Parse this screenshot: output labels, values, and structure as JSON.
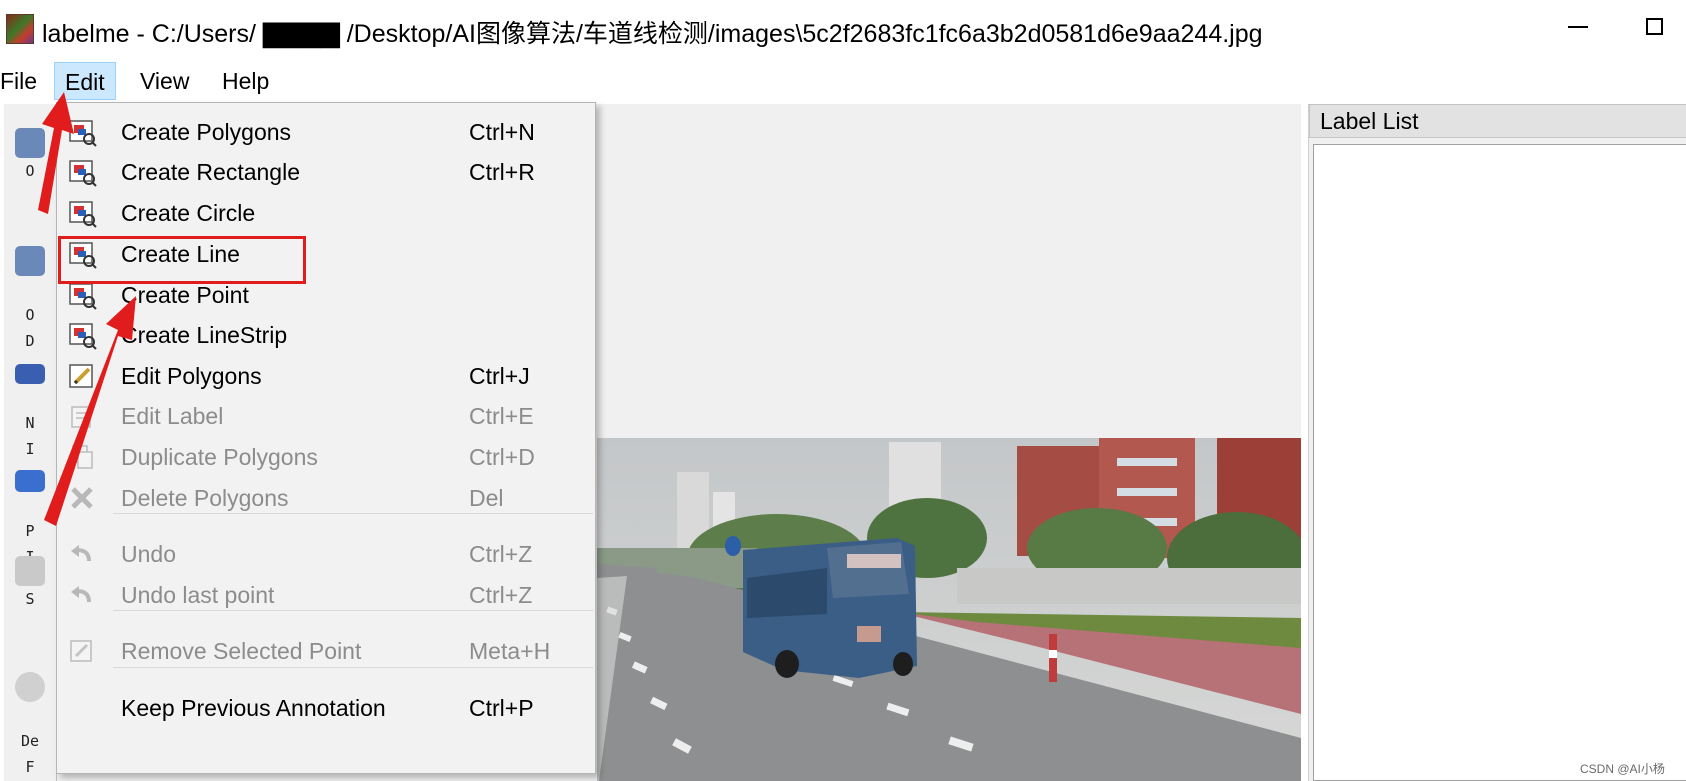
{
  "window": {
    "title": "labelme - C:/Users/ ▇▇▇▇ /Desktop/AI图像算法/车道线检测/images\\5c2f2683fc1fc6a3b2d0581d6e9aa244.jpg"
  },
  "menubar": [
    {
      "label": "File"
    },
    {
      "label": "Edit"
    },
    {
      "label": "View"
    },
    {
      "label": "Help"
    }
  ],
  "toolbar": [
    {
      "label": "O",
      "icon": "open-icon"
    },
    {
      "label": "O\nD",
      "icon": "open-dir-icon"
    },
    {
      "label": "N\nI",
      "icon": "next-image-icon"
    },
    {
      "label": "P\nI",
      "icon": "prev-image-icon"
    },
    {
      "label": "S",
      "icon": "save-icon"
    },
    {
      "label": "De\nF",
      "icon": "delete-file-icon"
    }
  ],
  "dock": {
    "title": "Label List"
  },
  "edit_menu": [
    {
      "label": "Create Polygons",
      "shortcut": "Ctrl+N",
      "icon": "create-shape-icon",
      "enabled": true
    },
    {
      "label": "Create Rectangle",
      "shortcut": "Ctrl+R",
      "icon": "create-shape-icon",
      "enabled": true
    },
    {
      "label": "Create Circle",
      "shortcut": "",
      "icon": "create-shape-icon",
      "enabled": true
    },
    {
      "label": "Create Line",
      "shortcut": "",
      "icon": "create-shape-icon",
      "enabled": true
    },
    {
      "label": "Create Point",
      "shortcut": "",
      "icon": "create-shape-icon",
      "enabled": true
    },
    {
      "label": "Create LineStrip",
      "shortcut": "",
      "icon": "create-shape-icon",
      "enabled": true
    },
    {
      "label": "Edit Polygons",
      "shortcut": "Ctrl+J",
      "icon": "edit-icon",
      "enabled": true
    },
    {
      "label": "Edit Label",
      "shortcut": "Ctrl+E",
      "icon": "edit-label-icon",
      "enabled": false
    },
    {
      "label": "Duplicate Polygons",
      "shortcut": "Ctrl+D",
      "icon": "copy-icon",
      "enabled": false
    },
    {
      "label": "Delete Polygons",
      "shortcut": "Del",
      "icon": "delete-icon",
      "enabled": false
    },
    {
      "label": "Undo",
      "shortcut": "Ctrl+Z",
      "icon": "undo-icon",
      "enabled": false
    },
    {
      "label": "Undo last point",
      "shortcut": "Ctrl+Z",
      "icon": "undo-icon",
      "enabled": false
    },
    {
      "label": "Remove Selected Point",
      "shortcut": "Meta+H",
      "icon": "edit-icon",
      "enabled": false
    },
    {
      "label": "Keep Previous Annotation",
      "shortcut": "Ctrl+P",
      "icon": "",
      "enabled": true
    }
  ],
  "watermark": "CSDN @AI小杨",
  "colors": {
    "menu_active_bg": "#cce8ff",
    "annotation_red": "#e01c1c",
    "disabled_text": "#8c8c8c"
  }
}
